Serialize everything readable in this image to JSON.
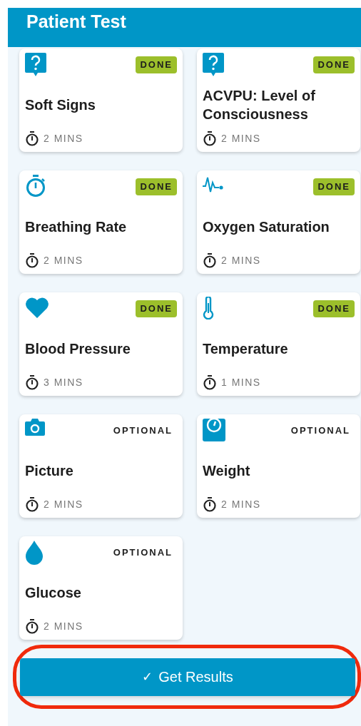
{
  "header": {
    "title": "Patient Test"
  },
  "tests": [
    {
      "status": {
        "kind": "done",
        "label": "DONE"
      },
      "title": "Soft Signs",
      "duration": "2 MINS"
    },
    {
      "status": {
        "kind": "done",
        "label": "DONE"
      },
      "title": "ACVPU: Level of Consciousness",
      "duration": "2 MINS"
    },
    {
      "status": {
        "kind": "done",
        "label": "DONE"
      },
      "title": "Breathing Rate",
      "duration": "2 MINS"
    },
    {
      "status": {
        "kind": "done",
        "label": "DONE"
      },
      "title": "Oxygen Saturation",
      "duration": "2 MINS"
    },
    {
      "status": {
        "kind": "done",
        "label": "DONE"
      },
      "title": "Blood Pressure",
      "duration": "3 MINS"
    },
    {
      "status": {
        "kind": "done",
        "label": "DONE"
      },
      "title": "Temperature",
      "duration": "1 MINS"
    },
    {
      "status": {
        "kind": "optional",
        "label": "OPTIONAL"
      },
      "title": "Picture",
      "duration": "2 MINS"
    },
    {
      "status": {
        "kind": "optional",
        "label": "OPTIONAL"
      },
      "title": "Weight",
      "duration": "2 MINS"
    },
    {
      "status": {
        "kind": "optional",
        "label": "OPTIONAL"
      },
      "title": "Glucose",
      "duration": "2 MINS"
    }
  ],
  "action_button": {
    "icon": "✓",
    "label": "Get Results",
    "highlighted": true
  }
}
